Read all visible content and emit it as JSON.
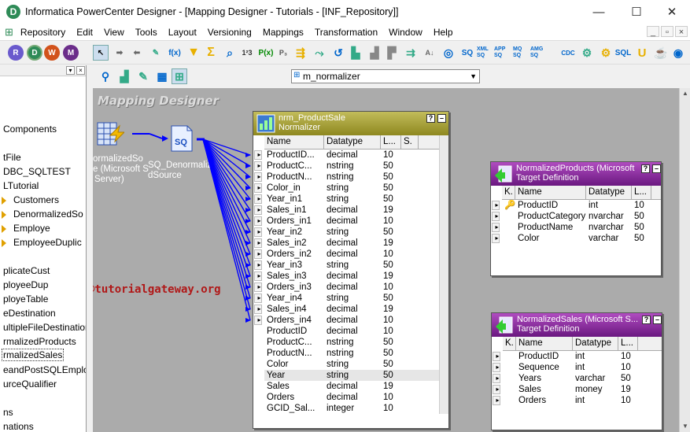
{
  "window": {
    "title": "Informatica PowerCenter Designer - [Mapping Designer - Tutorials - [INF_Repository]]",
    "app_icon_letter": "D"
  },
  "menubar": [
    "Repository",
    "Edit",
    "View",
    "Tools",
    "Layout",
    "Versioning",
    "Mappings",
    "Transformation",
    "Window",
    "Help"
  ],
  "toolbar": {
    "mapping_combo_value": "m_normalizer",
    "icons": [
      "R",
      "D",
      "W",
      "M"
    ],
    "text_icons": [
      "f(x)",
      "Σ",
      "P(x)",
      "SQ",
      "XML SQ",
      "APP SQ",
      "MQ SQ",
      "AMG SQ",
      "CDC",
      "SQL",
      "U"
    ]
  },
  "left_panel": {
    "items": [
      {
        "label": "Components",
        "kind": "text"
      },
      {
        "label": "tFile",
        "kind": "text"
      },
      {
        "label": "DBC_SQLTEST",
        "kind": "text"
      },
      {
        "label": "LTutorial",
        "kind": "text"
      },
      {
        "label": "Customers",
        "kind": "folder"
      },
      {
        "label": "DenormalizedSo",
        "kind": "folder"
      },
      {
        "label": "Employe",
        "kind": "folder"
      },
      {
        "label": "EmployeeDuplic",
        "kind": "folder"
      },
      {
        "label": "plicateCust",
        "kind": "text"
      },
      {
        "label": "ployeeDup",
        "kind": "text"
      },
      {
        "label": "ployeTable",
        "kind": "text"
      },
      {
        "label": "eDestination",
        "kind": "text"
      },
      {
        "label": "ultipleFileDestination",
        "kind": "text"
      },
      {
        "label": "rmalizedProducts",
        "kind": "text"
      },
      {
        "label": "rmalizedSales",
        "kind": "selected"
      },
      {
        "label": "eandPostSQLEmploy",
        "kind": "text"
      },
      {
        "label": "urceQualifier",
        "kind": "text"
      },
      {
        "label": "ns",
        "kind": "text"
      },
      {
        "label": "nations",
        "kind": "text"
      }
    ]
  },
  "canvas": {
    "title": "Mapping Designer",
    "watermark": "©tutorialgateway.org",
    "source_label": [
      "ormalizedSo",
      "e (Microsoft S",
      "Server)"
    ],
    "sq_label": [
      "SQ_Denormalize",
      "dSource"
    ]
  },
  "normalizer": {
    "title_line1": "nrm_ProductSale",
    "title_line2": "Normalizer",
    "columns": [
      "Name",
      "Datatype",
      "L...",
      "S."
    ],
    "rows": [
      {
        "name": "ProductID...",
        "type": "decimal",
        "len": "10",
        "in": true,
        "out": false
      },
      {
        "name": "ProductC...",
        "type": "nstring",
        "len": "50",
        "in": true,
        "out": false
      },
      {
        "name": "ProductN...",
        "type": "nstring",
        "len": "50",
        "in": true,
        "out": false
      },
      {
        "name": "Color_in",
        "type": "string",
        "len": "50",
        "in": true,
        "out": false
      },
      {
        "name": "Year_in1",
        "type": "string",
        "len": "50",
        "in": true,
        "out": false
      },
      {
        "name": "Sales_in1",
        "type": "decimal",
        "len": "19",
        "in": true,
        "out": false
      },
      {
        "name": "Orders_in1",
        "type": "decimal",
        "len": "10",
        "in": true,
        "out": false
      },
      {
        "name": "Year_in2",
        "type": "string",
        "len": "50",
        "in": true,
        "out": false
      },
      {
        "name": "Sales_in2",
        "type": "decimal",
        "len": "19",
        "in": true,
        "out": false
      },
      {
        "name": "Orders_in2",
        "type": "decimal",
        "len": "10",
        "in": true,
        "out": false
      },
      {
        "name": "Year_in3",
        "type": "string",
        "len": "50",
        "in": true,
        "out": false
      },
      {
        "name": "Sales_in3",
        "type": "decimal",
        "len": "19",
        "in": true,
        "out": false
      },
      {
        "name": "Orders_in3",
        "type": "decimal",
        "len": "10",
        "in": true,
        "out": false
      },
      {
        "name": "Year_in4",
        "type": "string",
        "len": "50",
        "in": true,
        "out": false
      },
      {
        "name": "Sales_in4",
        "type": "decimal",
        "len": "19",
        "in": true,
        "out": false
      },
      {
        "name": "Orders_in4",
        "type": "decimal",
        "len": "10",
        "in": true,
        "out": false
      },
      {
        "name": "ProductID",
        "type": "decimal",
        "len": "10",
        "in": false,
        "out": true
      },
      {
        "name": "ProductC...",
        "type": "nstring",
        "len": "50",
        "in": false,
        "out": true
      },
      {
        "name": "ProductN...",
        "type": "nstring",
        "len": "50",
        "in": false,
        "out": true
      },
      {
        "name": "Color",
        "type": "string",
        "len": "50",
        "in": false,
        "out": true
      },
      {
        "name": "Year",
        "type": "string",
        "len": "50",
        "in": false,
        "out": true
      },
      {
        "name": "Sales",
        "type": "decimal",
        "len": "19",
        "in": false,
        "out": true
      },
      {
        "name": "Orders",
        "type": "decimal",
        "len": "10",
        "in": false,
        "out": true
      },
      {
        "name": "GCID_Sal...",
        "type": "integer",
        "len": "10",
        "in": false,
        "out": true
      }
    ]
  },
  "target_products": {
    "title_line1": "NormalizedProducts (Microsoft",
    "title_line2": "Target Definition",
    "columns": [
      "K.",
      "Name",
      "Datatype",
      "L..."
    ],
    "rows": [
      {
        "key": "🔑",
        "name": "ProductID",
        "type": "int",
        "len": "10"
      },
      {
        "key": "",
        "name": "ProductCategory",
        "type": "nvarchar",
        "len": "50"
      },
      {
        "key": "",
        "name": "ProductName",
        "type": "nvarchar",
        "len": "50"
      },
      {
        "key": "",
        "name": "Color",
        "type": "varchar",
        "len": "50"
      }
    ]
  },
  "target_sales": {
    "title_line1": "NormalizedSales (Microsoft S...",
    "title_line2": "Target Definition",
    "columns": [
      "K.",
      "Name",
      "Datatype",
      "L..."
    ],
    "rows": [
      {
        "key": "",
        "name": "ProductID",
        "type": "int",
        "len": "10"
      },
      {
        "key": "",
        "name": "Sequence",
        "type": "int",
        "len": "10"
      },
      {
        "key": "",
        "name": "Years",
        "type": "varchar",
        "len": "50"
      },
      {
        "key": "",
        "name": "Sales",
        "type": "money",
        "len": "19"
      },
      {
        "key": "",
        "name": "Orders",
        "type": "int",
        "len": "10"
      }
    ]
  },
  "colors": {
    "normalizer_header": "#a8a23c",
    "target_header": "#8e2a9a",
    "link": "#0000ff",
    "canvas_bg": "#ababab"
  }
}
